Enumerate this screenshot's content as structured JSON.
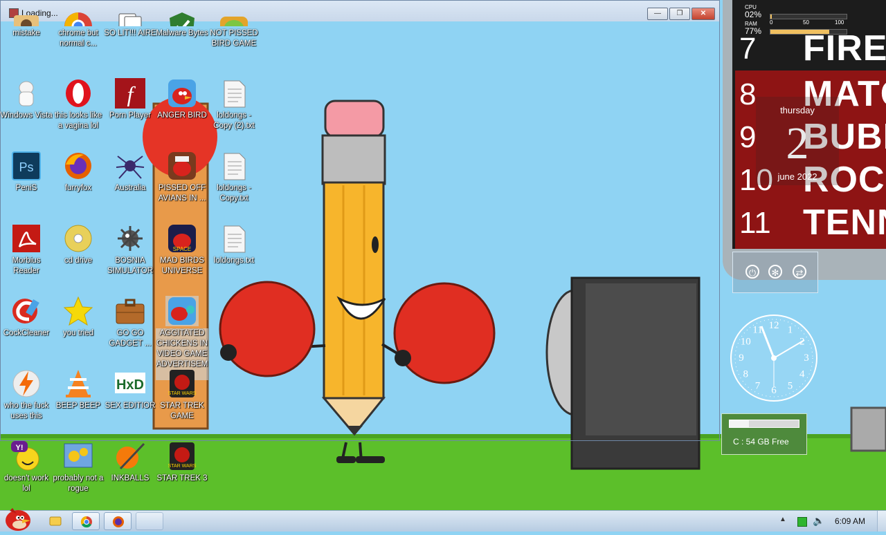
{
  "window": {
    "title": "Loading...",
    "buttons": {
      "minimize": "—",
      "maximize": "❐",
      "close": "✕"
    }
  },
  "icons": [
    {
      "label": "mistake",
      "icon": "user-folder-icon"
    },
    {
      "label": "chrome but normal c...",
      "icon": "chrome-icon"
    },
    {
      "label": "SO LIT!!! AIRE",
      "icon": "solitaire-icon"
    },
    {
      "label": "Malware Bytes",
      "icon": "malwarebytes-icon"
    },
    {
      "label": "NOT PISSED BIRD GAME",
      "icon": "pig-game-icon"
    },
    {
      "label": "Windows Vista",
      "icon": "toilet-icon"
    },
    {
      "label": "this looks like a vagina lol",
      "icon": "opera-icon"
    },
    {
      "label": "Porn Player",
      "icon": "flash-player-icon"
    },
    {
      "label": "ANGER BIRD",
      "icon": "angry-bird-icon"
    },
    {
      "label": "loldongs - Copy (2).txt",
      "icon": "text-file-icon"
    },
    {
      "label": "PeniS",
      "icon": "photoshop-icon"
    },
    {
      "label": "furryfox",
      "icon": "firefox-icon"
    },
    {
      "label": "Australia",
      "icon": "spider-solitaire-icon"
    },
    {
      "label": "PISSED OFF AVIANS IN ...",
      "icon": "angry-birds-seasons-icon"
    },
    {
      "label": "loldongs - Copy.txt",
      "icon": "text-file-icon"
    },
    {
      "label": "Morbius Reader",
      "icon": "acrobat-icon"
    },
    {
      "label": "cd drive",
      "icon": "cd-icon"
    },
    {
      "label": "BOSNIA SIMULATOR",
      "icon": "minesweeper-icon"
    },
    {
      "label": "MAD BIRDS UNIVERSE",
      "icon": "angry-birds-space-icon"
    },
    {
      "label": "loldongs.txt",
      "icon": "text-file-icon"
    },
    {
      "label": "CockCleaner",
      "icon": "ccleaner-icon"
    },
    {
      "label": "you tried",
      "icon": "star-icon"
    },
    {
      "label": "GO GO GADGET ...",
      "icon": "briefcase-icon"
    },
    {
      "label": "AGGITATED CHICKENS IN VIDEO GAME ADVERTISEMENT",
      "icon": "angry-birds-rio-icon"
    },
    {
      "label": "who the fuck uses this",
      "icon": "winamp-icon"
    },
    {
      "label": "BEEP BEEP",
      "icon": "vlc-icon"
    },
    {
      "label": "SEX EDITIOR",
      "icon": "hxd-icon"
    },
    {
      "label": "STAR TREK GAME",
      "icon": "star-wars-icon"
    },
    {
      "label": "doesn't work lol",
      "icon": "yahoo-messenger-icon"
    },
    {
      "label": "probably not a rogue",
      "icon": "gears-icon"
    },
    {
      "label": "INKBALLS",
      "icon": "inkball-icon"
    },
    {
      "label": "STAR TREK 3",
      "icon": "star-wars-icon"
    }
  ],
  "gadgets": {
    "cpu": {
      "cpu_label": "CPU",
      "cpu_value": "02%",
      "ram_label": "RAM",
      "ram_value": "77%",
      "scale": [
        "0",
        "50",
        "100"
      ],
      "cpu_fraction": 0.02,
      "ram_fraction": 0.77
    },
    "calendar": {
      "day": "thursday",
      "date": "2",
      "month_year": "june 2022"
    },
    "disk": {
      "label": "C : 54 GB Free",
      "fill_fraction": 0.28
    },
    "scoreboard": [
      {
        "num": "7",
        "word": "FIRE"
      },
      {
        "num": "8",
        "word": "MATC"
      },
      {
        "num": "9",
        "word": "BUBB"
      },
      {
        "num": "10",
        "word": "ROCK"
      },
      {
        "num": "11",
        "word": "TENN"
      }
    ],
    "clock": {
      "numbers": [
        "12",
        "1",
        "2",
        "3",
        "4",
        "5",
        "6",
        "7",
        "8",
        "9",
        "10",
        "11"
      ]
    }
  },
  "taskbar": {
    "time": "6:09 AM",
    "pinned": [
      "explorer-icon",
      "chrome-icon",
      "firefox-icon",
      "blank-icon"
    ]
  },
  "colors": {
    "sky": "#8fd3f3",
    "grass": "#5cbf2a",
    "taskbar": "#c6d8ec"
  }
}
